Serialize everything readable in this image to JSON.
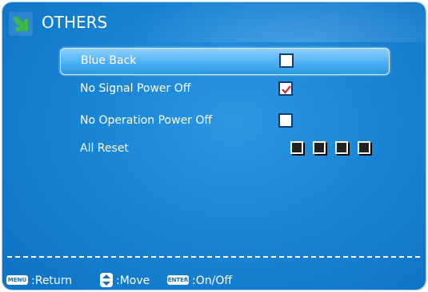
{
  "header": {
    "title": "OTHERS",
    "icon": "green-arrow-down-right-icon"
  },
  "menu": {
    "items": [
      {
        "label": "Blue Back",
        "control": "checkbox",
        "checked": false,
        "selected": true
      },
      {
        "label": "No Signal Power Off",
        "control": "checkbox",
        "checked": true,
        "selected": false
      },
      {
        "label": "No Operation Power Off",
        "control": "checkbox",
        "checked": false,
        "selected": false
      },
      {
        "label": "All Reset",
        "control": "squares",
        "squares": 4,
        "selected": false
      }
    ]
  },
  "footer": {
    "menu_key": "MENU",
    "return_label": ":Return",
    "move_label": ":Move",
    "enter_key": "ENTER",
    "onoff_label": ":On/Off"
  },
  "colors": {
    "panel_bg": "#1a86d6",
    "selected_row": "#4db1f2",
    "check_mark": "#d0283c",
    "title_icon": "#3fb84a"
  }
}
